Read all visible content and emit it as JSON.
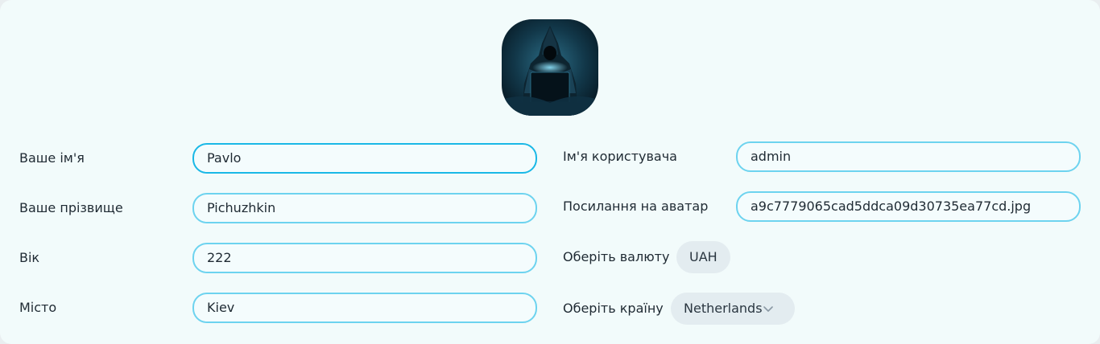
{
  "profile": {
    "avatar_icon": "hooded-figure-avatar",
    "left": {
      "first_name": {
        "label": "Ваше ім'я",
        "value": "Pavlo"
      },
      "last_name": {
        "label": "Ваше прізвище",
        "value": "Pichuzhkin"
      },
      "age": {
        "label": "Вік",
        "value": "222"
      },
      "city": {
        "label": "Місто",
        "value": "Kiev"
      }
    },
    "right": {
      "username": {
        "label": "Ім'я користувача",
        "value": "admin"
      },
      "avatar_link": {
        "label": "Посилання на аватар",
        "value": "a9c7779065cad5ddca09d30735ea77cd.jpg"
      },
      "currency": {
        "label": "Оберіть валюту",
        "value": "UAH"
      },
      "country": {
        "label": "Оберіть країну",
        "value": "Netherlands",
        "icon": "chevron-down-icon"
      }
    }
  },
  "colors": {
    "background": "#f2fbfb",
    "input_border": "#6dd3ef",
    "input_border_focus": "#1ab8e6",
    "pill_bg": "#e3ecf0"
  }
}
